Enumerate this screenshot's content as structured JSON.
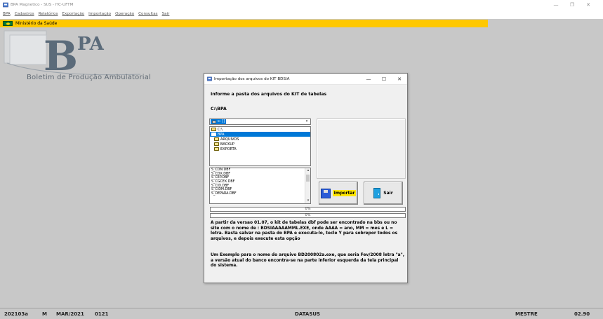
{
  "window": {
    "title": "BPA Magnetico - SUS - HC-UFTM",
    "controls": [
      "—",
      "❐",
      "✕"
    ]
  },
  "menubar": {
    "items": [
      "BPA",
      "Cadastros",
      "Relatórios",
      "Exportação",
      "Importação",
      "Operação",
      "Consultas",
      "Sair"
    ]
  },
  "banner": {
    "org": "Ministério da Saúde",
    "color": "#ffc800"
  },
  "logo": {
    "letters_big": "B",
    "letters_small": "PA",
    "subtitle": "Boletim de Produção Ambulatorial"
  },
  "dialog": {
    "title": "Importação dos arquivos do KIT BDSIA",
    "controls": [
      "—",
      "☐",
      "✕"
    ],
    "prompt": "Informe a pasta dos arquivos do KIT de tabelas",
    "path": "C:\\BPA",
    "drive": "c: []",
    "dirs": [
      {
        "name": "C:\\",
        "selected": false
      },
      {
        "name": "BPA",
        "selected": true
      },
      {
        "name": "ARQUIVOS",
        "selected": false
      },
      {
        "name": "BACKUP",
        "selected": false
      },
      {
        "name": "EXPORTA",
        "selected": false
      }
    ],
    "files": [
      "S_CDN.DBF",
      "S_CDX.DBF",
      "S_CEP.DBF",
      "S_CGCEX.DBF",
      "S_CID.DBF",
      "S_CIDM.DBF",
      "S_DEPARA.DBF"
    ],
    "import_label": "Importar",
    "exit_label": "Sair",
    "progress1": {
      "text": "0%",
      "value": 0
    },
    "progress2": {
      "text": "0%",
      "value": 0
    },
    "info1": "A partir da versao 01.07, o kit de tabelas dbf pode ser encontrado na bbs ou no site com o nome de : BDSIAAAAAMML.EXE, onde AAAA = ano, MM = mes e L = letra. Basta salvar na pasta do BPA e executa-lo, tecle Y para sobrepor todos os arquivos, e depois execute esta opção",
    "info2": "Um Exemplo para o nome do arquivo BD200802a.exe, que seria Fev/2008 letra \"a\", a versão atual do banco encontra-se na parte inferior esquerda da tela principal do sistema."
  },
  "statusbar": {
    "version_code": "202103a",
    "mode": "M",
    "competence": "MAR/2021",
    "code": "0121",
    "org": "DATASUS",
    "user": "MESTRE",
    "app_version": "02.90"
  }
}
